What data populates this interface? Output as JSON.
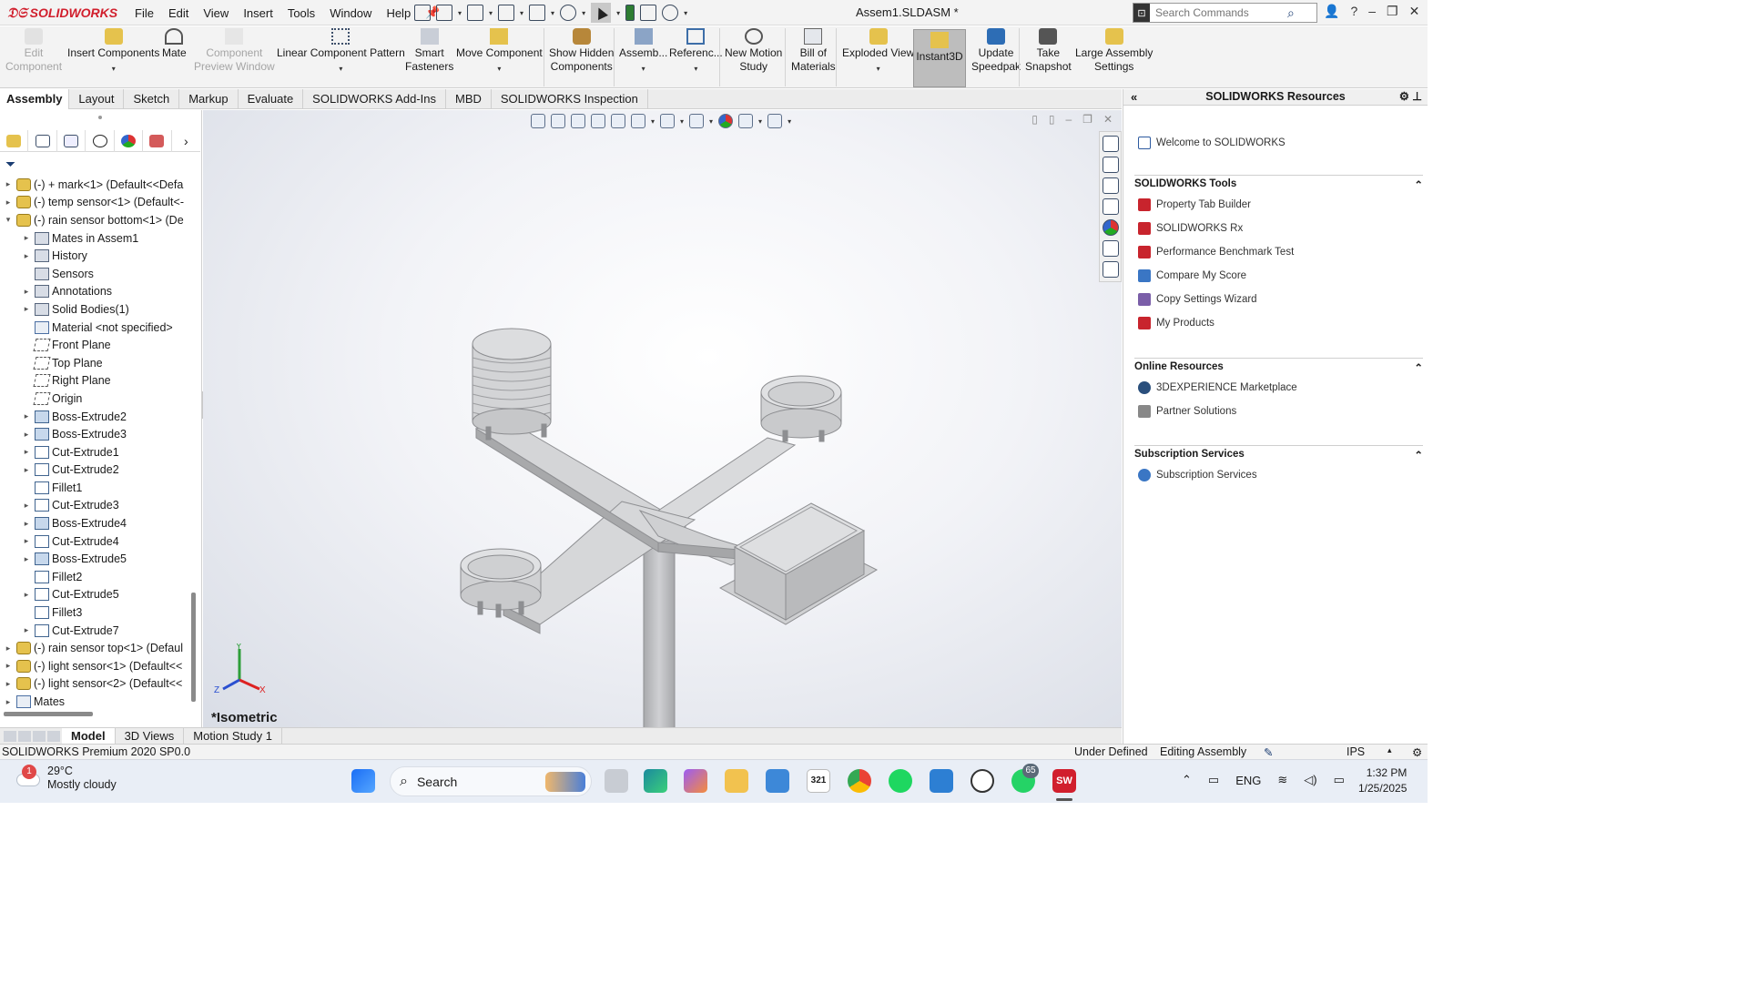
{
  "app": {
    "brand": "SOLIDWORKS",
    "doc_title": "Assem1.SLDASM *"
  },
  "menu": [
    "File",
    "Edit",
    "View",
    "Insert",
    "Tools",
    "Window",
    "Help"
  ],
  "search": {
    "placeholder": "Search Commands"
  },
  "commands": [
    {
      "l1": "Edit",
      "l2": "Component",
      "disabled": true
    },
    {
      "l1": "Insert Components",
      "l2": "",
      "disabled": false,
      "caret": true
    },
    {
      "l1": "Mate",
      "l2": "",
      "disabled": false
    },
    {
      "l1": "Component",
      "l2": "Preview Window",
      "disabled": true
    },
    {
      "l1": "Linear Component Pattern",
      "l2": "",
      "disabled": false,
      "caret": true
    },
    {
      "l1": "Smart",
      "l2": "Fasteners",
      "disabled": false
    },
    {
      "l1": "Move Component",
      "l2": "",
      "disabled": false,
      "caret": true
    },
    {
      "l1": "Show Hidden",
      "l2": "Components",
      "disabled": false
    },
    {
      "l1": "Assemb...",
      "l2": "",
      "disabled": false,
      "caret": true
    },
    {
      "l1": "Referenc...",
      "l2": "",
      "disabled": false,
      "caret": true
    },
    {
      "l1": "New Motion",
      "l2": "Study",
      "disabled": false
    },
    {
      "l1": "Bill of",
      "l2": "Materials",
      "disabled": false
    },
    {
      "l1": "Exploded View",
      "l2": "",
      "disabled": false,
      "caret": true
    },
    {
      "l1": "Instant3D",
      "l2": "",
      "disabled": false,
      "active": true
    },
    {
      "l1": "Update",
      "l2": "Speedpak",
      "disabled": false
    },
    {
      "l1": "Take",
      "l2": "Snapshot",
      "disabled": false
    },
    {
      "l1": "Large Assembly",
      "l2": "Settings",
      "disabled": false
    }
  ],
  "tabs": [
    "Assembly",
    "Layout",
    "Sketch",
    "Markup",
    "Evaluate",
    "SOLIDWORKS Add-Ins",
    "MBD",
    "SOLIDWORKS Inspection"
  ],
  "tree": [
    {
      "label": "(-) + mark<1> (Default<<Defa",
      "icon": "asm",
      "indent": 0,
      "arrow": "▸"
    },
    {
      "label": "(-) temp sensor<1> (Default<-",
      "icon": "asm",
      "indent": 0,
      "arrow": "▸"
    },
    {
      "label": "(-) rain sensor bottom<1> (De",
      "icon": "asm",
      "indent": 0,
      "arrow": "▾"
    },
    {
      "label": "Mates in Assem1",
      "icon": "fold",
      "indent": 1,
      "arrow": "▸"
    },
    {
      "label": "History",
      "icon": "fold",
      "indent": 1,
      "arrow": "▸"
    },
    {
      "label": "Sensors",
      "icon": "fold",
      "indent": 1,
      "arrow": ""
    },
    {
      "label": "Annotations",
      "icon": "fold",
      "indent": 1,
      "arrow": "▸"
    },
    {
      "label": "Solid Bodies(1)",
      "icon": "fold",
      "indent": 1,
      "arrow": "▸"
    },
    {
      "label": "Material <not specified>",
      "icon": "mates",
      "indent": 1,
      "arrow": ""
    },
    {
      "label": "Front Plane",
      "icon": "plane",
      "indent": 1,
      "arrow": ""
    },
    {
      "label": "Top Plane",
      "icon": "plane",
      "indent": 1,
      "arrow": ""
    },
    {
      "label": "Right Plane",
      "icon": "plane",
      "indent": 1,
      "arrow": ""
    },
    {
      "label": "Origin",
      "icon": "plane",
      "indent": 1,
      "arrow": ""
    },
    {
      "label": "Boss-Extrude2",
      "icon": "feat",
      "indent": 1,
      "arrow": "▸"
    },
    {
      "label": "Boss-Extrude3",
      "icon": "feat",
      "indent": 1,
      "arrow": "▸"
    },
    {
      "label": "Cut-Extrude1",
      "icon": "cut",
      "indent": 1,
      "arrow": "▸"
    },
    {
      "label": "Cut-Extrude2",
      "icon": "cut",
      "indent": 1,
      "arrow": "▸"
    },
    {
      "label": "Fillet1",
      "icon": "cut",
      "indent": 1,
      "arrow": ""
    },
    {
      "label": "Cut-Extrude3",
      "icon": "cut",
      "indent": 1,
      "arrow": "▸"
    },
    {
      "label": "Boss-Extrude4",
      "icon": "feat",
      "indent": 1,
      "arrow": "▸"
    },
    {
      "label": "Cut-Extrude4",
      "icon": "cut",
      "indent": 1,
      "arrow": "▸"
    },
    {
      "label": "Boss-Extrude5",
      "icon": "feat",
      "indent": 1,
      "arrow": "▸"
    },
    {
      "label": "Fillet2",
      "icon": "cut",
      "indent": 1,
      "arrow": ""
    },
    {
      "label": "Cut-Extrude5",
      "icon": "cut",
      "indent": 1,
      "arrow": "▸"
    },
    {
      "label": "Fillet3",
      "icon": "cut",
      "indent": 1,
      "arrow": ""
    },
    {
      "label": "Cut-Extrude7",
      "icon": "cut",
      "indent": 1,
      "arrow": "▸"
    },
    {
      "label": "(-) rain sensor top<1> (Defaul",
      "icon": "asm",
      "indent": 0,
      "arrow": "▸"
    },
    {
      "label": "(-) light sensor<1> (Default<<",
      "icon": "asm",
      "indent": 0,
      "arrow": "▸"
    },
    {
      "label": "(-) light sensor<2> (Default<<",
      "icon": "asm",
      "indent": 0,
      "arrow": "▸"
    },
    {
      "label": "Mates",
      "icon": "mates",
      "indent": 0,
      "arrow": "▸"
    }
  ],
  "viewport": {
    "view_label": "*Isometric"
  },
  "bottom_tabs": [
    "Model",
    "3D Views",
    "Motion Study 1"
  ],
  "status": {
    "product": "SOLIDWORKS Premium 2020 SP0.0",
    "state": "Under Defined",
    "mode": "Editing Assembly",
    "units": "IPS"
  },
  "task_pane": {
    "title": "SOLIDWORKS Resources",
    "welcome": "Welcome to SOLIDWORKS",
    "sections": [
      {
        "title": "SOLIDWORKS Tools",
        "items": [
          "Property Tab Builder",
          "SOLIDWORKS Rx",
          "Performance Benchmark Test",
          "Compare My Score",
          "Copy Settings Wizard",
          "My Products"
        ]
      },
      {
        "title": "Online Resources",
        "items": [
          "3DEXPERIENCE Marketplace",
          "Partner Solutions"
        ]
      },
      {
        "title": "Subscription Services",
        "items": [
          "Subscription Services"
        ]
      }
    ]
  },
  "taskbar": {
    "temp": "29°C",
    "weather": "Mostly cloudy",
    "weather_badge": "1",
    "search": "Search",
    "lang": "ENG",
    "time": "1:32 PM",
    "date": "1/25/2025",
    "whatsapp_badge": "65",
    "calendar_day": "321"
  },
  "colors": {
    "brand_red": "#d11f2d",
    "accent_blue": "#1c3e73"
  }
}
